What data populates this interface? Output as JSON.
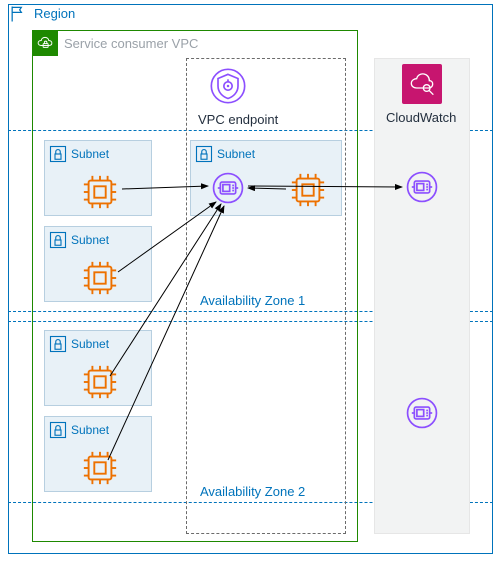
{
  "region": {
    "label": "Region"
  },
  "vpc": {
    "label": "Service consumer VPC"
  },
  "endpoint": {
    "label": "VPC endpoint"
  },
  "cloudwatch": {
    "label": "CloudWatch"
  },
  "az": {
    "zone1": "Availability Zone 1",
    "zone2": "Availability Zone 2"
  },
  "subnets": {
    "a": {
      "label": "Subnet"
    },
    "b": {
      "label": "Subnet"
    },
    "c": {
      "label": "Subnet"
    },
    "d": {
      "label": "Subnet"
    },
    "e": {
      "label": "Subnet"
    }
  },
  "colors": {
    "region": "#0073bb",
    "vpc": "#1e8900",
    "chip": "#ed7100",
    "eni": "#8c4fff",
    "cw": "#c7156f"
  },
  "chart_data": {
    "type": "diagram",
    "nodes": [
      {
        "id": "region",
        "kind": "region",
        "label": "Region"
      },
      {
        "id": "vpc",
        "kind": "vpc",
        "label": "Service consumer VPC",
        "parent": "region"
      },
      {
        "id": "az1",
        "kind": "az",
        "label": "Availability Zone 1",
        "parent": "vpc"
      },
      {
        "id": "az2",
        "kind": "az",
        "label": "Availability Zone 2",
        "parent": "vpc"
      },
      {
        "id": "subnet_a",
        "kind": "subnet",
        "label": "Subnet",
        "parent": "az1"
      },
      {
        "id": "subnet_b",
        "kind": "subnet",
        "label": "Subnet",
        "parent": "az1"
      },
      {
        "id": "subnet_c",
        "kind": "subnet",
        "label": "Subnet",
        "parent": "az2"
      },
      {
        "id": "subnet_d",
        "kind": "subnet",
        "label": "Subnet",
        "parent": "az2"
      },
      {
        "id": "subnet_e",
        "kind": "subnet",
        "label": "Subnet",
        "parent": "az1",
        "note": "subnet hosting the interface endpoint"
      },
      {
        "id": "chip_a",
        "kind": "compute",
        "parent": "subnet_a"
      },
      {
        "id": "chip_b",
        "kind": "compute",
        "parent": "subnet_b"
      },
      {
        "id": "chip_c",
        "kind": "compute",
        "parent": "subnet_c"
      },
      {
        "id": "chip_d",
        "kind": "compute",
        "parent": "subnet_d"
      },
      {
        "id": "chip_e",
        "kind": "compute",
        "parent": "subnet_e"
      },
      {
        "id": "eni_endpoint",
        "kind": "network-interface",
        "parent": "subnet_e"
      },
      {
        "id": "cloudwatch",
        "kind": "service",
        "label": "CloudWatch",
        "parent": "region"
      },
      {
        "id": "eni_cw1",
        "kind": "network-interface",
        "parent": "cloudwatch",
        "zone": "az1"
      },
      {
        "id": "eni_cw2",
        "kind": "network-interface",
        "parent": "cloudwatch",
        "zone": "az2"
      }
    ],
    "edges": [
      {
        "from": "chip_a",
        "to": "eni_endpoint"
      },
      {
        "from": "chip_b",
        "to": "eni_endpoint"
      },
      {
        "from": "chip_c",
        "to": "eni_endpoint"
      },
      {
        "from": "chip_d",
        "to": "eni_endpoint"
      },
      {
        "from": "chip_e",
        "to": "eni_endpoint"
      },
      {
        "from": "eni_endpoint",
        "to": "eni_cw1"
      }
    ]
  }
}
